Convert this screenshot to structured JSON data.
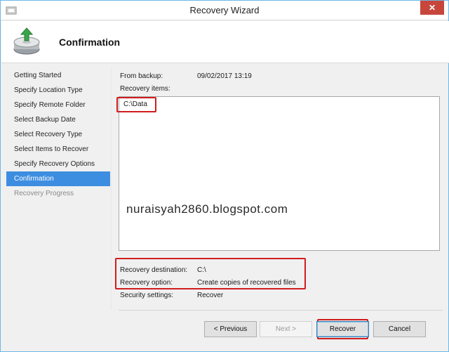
{
  "window": {
    "title": "Recovery Wizard",
    "close_glyph": "✕"
  },
  "header": {
    "title": "Confirmation",
    "icon": "backup-restore-icon"
  },
  "nav": {
    "items": [
      {
        "label": "Getting Started"
      },
      {
        "label": "Specify Location Type"
      },
      {
        "label": "Specify Remote Folder"
      },
      {
        "label": "Select Backup Date"
      },
      {
        "label": "Select Recovery Type"
      },
      {
        "label": "Select Items to Recover"
      },
      {
        "label": "Specify Recovery Options"
      },
      {
        "label": "Confirmation"
      },
      {
        "label": "Recovery Progress"
      }
    ],
    "active_index": 7
  },
  "content": {
    "from_backup_label": "From backup:",
    "from_backup_value": "09/02/2017 13:19",
    "recovery_items_label": "Recovery items:",
    "recovery_items": [
      "C:\\Data"
    ],
    "watermark": "nuraisyah2860.blogspot.com",
    "destination_label": "Recovery destination:",
    "destination_value": "C:\\",
    "option_label": "Recovery option:",
    "option_value": "Create copies of recovered files",
    "security_label": "Security settings:",
    "security_value": "Recover"
  },
  "buttons": {
    "previous": "< Previous",
    "next": "Next >",
    "recover": "Recover",
    "cancel": "Cancel"
  },
  "colors": {
    "accent": "#3d8ee0",
    "highlight": "#d01d1d",
    "close": "#c7463c"
  }
}
